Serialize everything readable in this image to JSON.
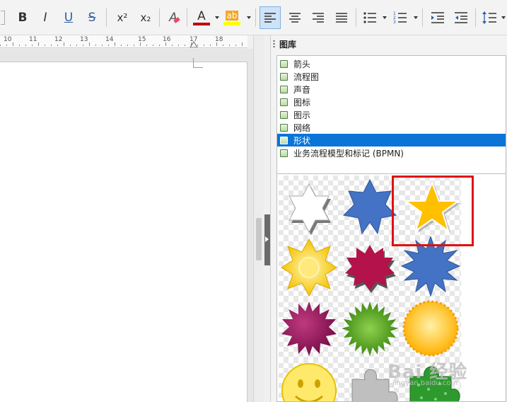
{
  "toolbar": {
    "bold": "B",
    "italic": "I",
    "underline": "U",
    "strikethrough": "S",
    "superscript": "x²",
    "subscript": "x₂",
    "clear_format": "A",
    "font_color": "A",
    "highlight": "ab",
    "font_color_hex": "#c00000",
    "highlight_hex": "#ffff00"
  },
  "ruler": {
    "numbers": [
      "10",
      "11",
      "12",
      "13",
      "14",
      "15",
      "16",
      "17",
      "18"
    ]
  },
  "panel": {
    "title": "图库"
  },
  "theme_list": {
    "items": [
      {
        "label": "箭头",
        "selected": false
      },
      {
        "label": "流程图",
        "selected": false
      },
      {
        "label": "声音",
        "selected": false
      },
      {
        "label": "图标",
        "selected": false
      },
      {
        "label": "图示",
        "selected": false
      },
      {
        "label": "网络",
        "selected": false
      },
      {
        "label": "形状",
        "selected": true
      },
      {
        "label": "业务流程模型和标记 (BPMN)",
        "selected": false
      }
    ]
  },
  "gallery": {
    "items": [
      {
        "name": "six-point-star-white",
        "color": "#ffffff"
      },
      {
        "name": "seven-point-star-blue",
        "color": "#4472c4"
      },
      {
        "name": "five-point-star-gold",
        "color": "#ffc000"
      },
      {
        "name": "eight-point-burst-yellow",
        "color": "#ffd84a"
      },
      {
        "name": "ten-point-burst-crimson",
        "color": "#b3124a"
      },
      {
        "name": "twelve-point-burst-blue",
        "color": "#4472c4"
      },
      {
        "name": "sixteen-point-burst-purple",
        "color": "#9b1b63"
      },
      {
        "name": "twenty-point-burst-green",
        "color": "#5aa524"
      },
      {
        "name": "twentyfour-point-burst-orange",
        "color": "#ffb300"
      },
      {
        "name": "smiley-face",
        "color": "#ffe96b"
      },
      {
        "name": "puzzle-piece-gray",
        "color": "#bfbfbf"
      },
      {
        "name": "puzzle-piece-green",
        "color": "#2e9a2e"
      }
    ],
    "highlight_color": "#e01010"
  },
  "watermark": {
    "text": "Bai 经验",
    "sub": "jingyan.baidu.com"
  }
}
